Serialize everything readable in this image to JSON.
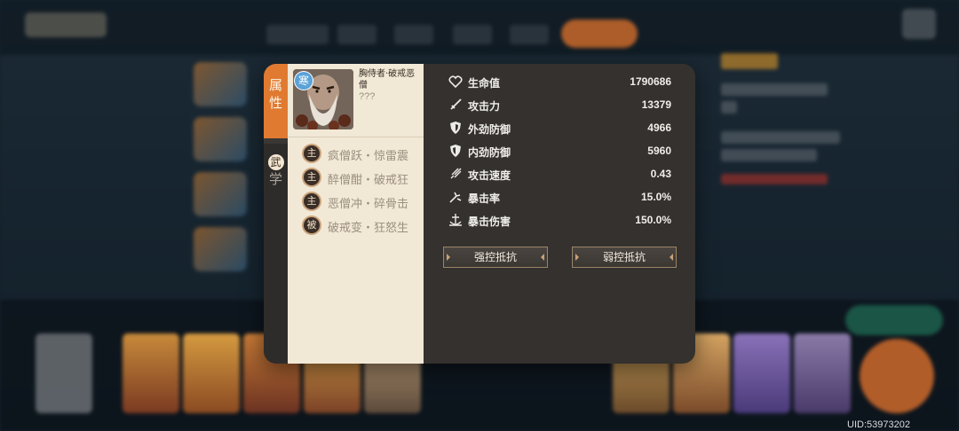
{
  "uid": "UID:53973202",
  "tabs": {
    "attributes": {
      "label_line1": "属",
      "label_line2": "性"
    },
    "martial": {
      "label_line1": "武",
      "label_line2": "学"
    }
  },
  "boss": {
    "name": "胸侍者·破戒恶僧",
    "subname": "???",
    "element_badge": "寒"
  },
  "skills": [
    {
      "badge": "主",
      "name": "疯僧跃・惊雷震"
    },
    {
      "badge": "主",
      "name": "醉僧酣・破戒狂"
    },
    {
      "badge": "主",
      "name": "恶僧冲・碎骨击"
    },
    {
      "badge": "被",
      "name": "破戒变・狂怒生"
    }
  ],
  "stats": [
    {
      "icon": "heart-icon",
      "label": "生命值",
      "value": "1790686"
    },
    {
      "icon": "sword-icon",
      "label": "攻击力",
      "value": "13379"
    },
    {
      "icon": "shield-icon",
      "label": "外劲防御",
      "value": "4966"
    },
    {
      "icon": "shield-icon",
      "label": "内劲防御",
      "value": "5960"
    },
    {
      "icon": "speed-icon",
      "label": "攻击速度",
      "value": "0.43"
    },
    {
      "icon": "crit-icon",
      "label": "暴击率",
      "value": "15.0%"
    },
    {
      "icon": "crit-damage-icon",
      "label": "暴击伤害",
      "value": "150.0%"
    }
  ],
  "buttons": {
    "strong_control": "强控抵抗",
    "weak_control": "弱控抵抗"
  },
  "colors": {
    "accent_orange": "#e07a31",
    "panel_dark": "#34312e",
    "panel_light": "#f2e8d6"
  }
}
